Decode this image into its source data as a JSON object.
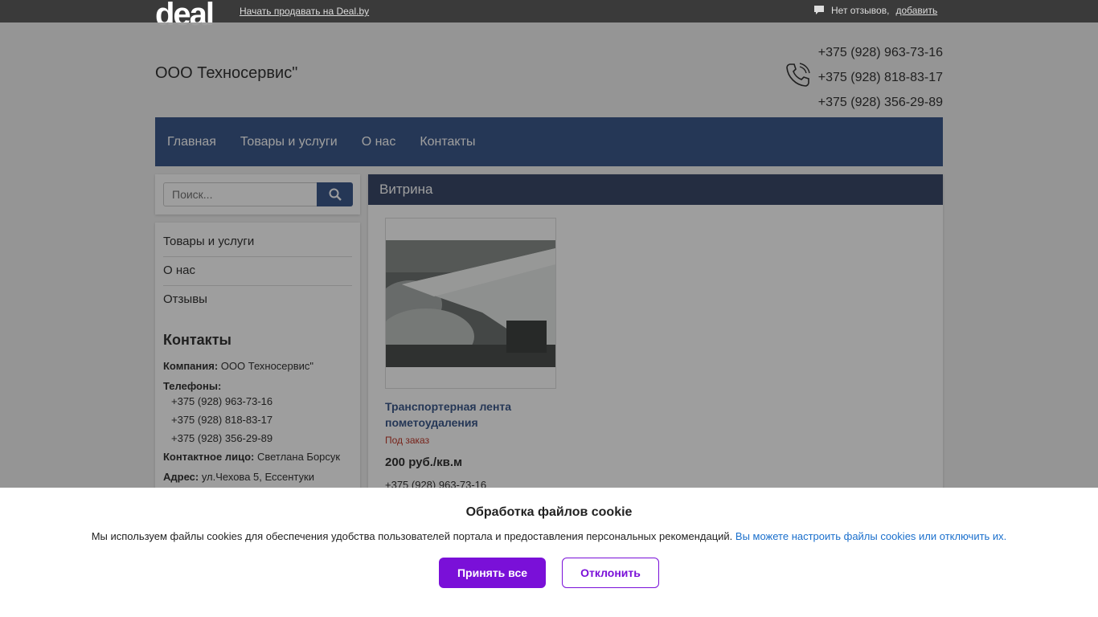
{
  "topbar": {
    "logo": "deal",
    "sell_link": "Начать продавать на Deal.by",
    "reviews_text": "Нет отзывов,",
    "reviews_add": "добавить"
  },
  "header": {
    "company_name": "ООО Техносервис\"",
    "phones": [
      "+375 (928) 963-73-16",
      "+375 (928) 818-83-17",
      "+375 (928) 356-29-89"
    ]
  },
  "nav": {
    "items": [
      "Главная",
      "Товары и услуги",
      "О нас",
      "Контакты"
    ]
  },
  "search": {
    "placeholder": "Поиск..."
  },
  "sidebar": {
    "items": [
      "Товары и услуги",
      "О нас",
      "Отзывы"
    ],
    "contacts_title": "Контакты",
    "company_label": "Компания:",
    "company_value": "ООО Техносервис\"",
    "phones_label": "Телефоны:",
    "phones": [
      "+375 (928) 963-73-16",
      "+375 (928) 818-83-17",
      "+375 (928) 356-29-89"
    ],
    "contact_person_label": "Контактное лицо:",
    "contact_person_value": "Светлана Борсук",
    "address_label": "Адрес:",
    "address_value": "ул.Чехова 5, Ессентуки"
  },
  "main": {
    "section_title": "Витрина",
    "product": {
      "title": "Транспортерная лента пометоудаления",
      "status": "Под заказ",
      "price": "200 руб./кв.м",
      "phone": "+375 (928) 963-73-16"
    }
  },
  "cookie": {
    "title": "Обработка файлов cookie",
    "text": "Мы используем файлы cookies для обеспечения удобства пользователей портала и предоставления персональных рекомендаций.",
    "link": "Вы можете настроить файлы cookies или отключить их.",
    "accept": "Принять все",
    "decline": "Отклонить"
  },
  "colors": {
    "nav": "#3d5a8c",
    "accent_purple": "#7a10d8",
    "link_blue": "#1a6fcc"
  }
}
